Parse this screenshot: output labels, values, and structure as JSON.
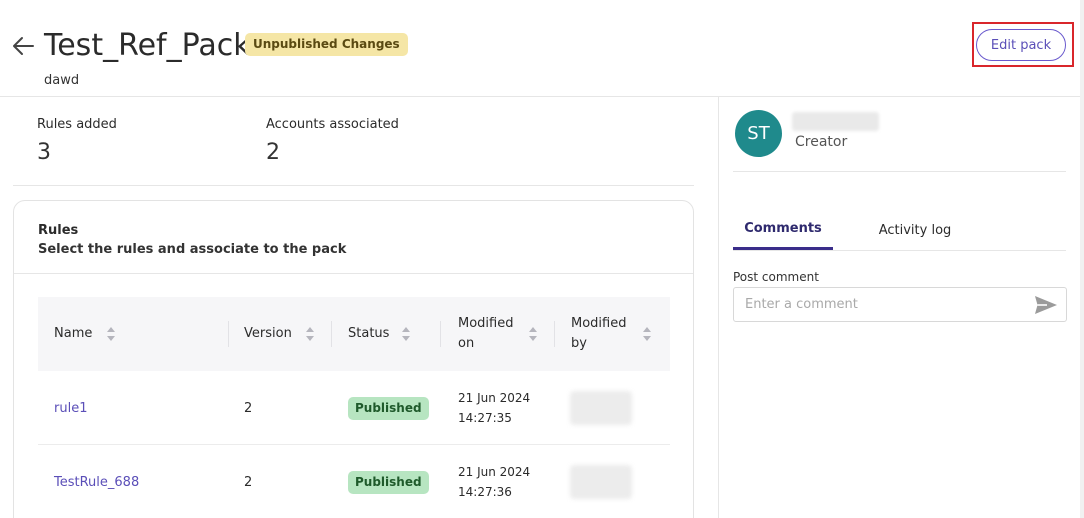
{
  "header": {
    "title": "Test_Ref_Pack",
    "status_badge": "Unpublished Changes",
    "subtitle": "dawd",
    "edit_button": "Edit pack"
  },
  "stats": {
    "rules_added": {
      "label": "Rules added",
      "value": "3"
    },
    "accounts_associated": {
      "label": "Accounts associated",
      "value": "2"
    }
  },
  "rules": {
    "title": "Rules",
    "description": "Select the rules and associate to the pack",
    "columns": [
      "Name",
      "Version",
      "Status",
      "Modified on",
      "Modified by"
    ],
    "rows": [
      {
        "name": "rule1",
        "version": "2",
        "status": "Published",
        "modified_date": "21 Jun 2024",
        "modified_time": "14:27:35"
      },
      {
        "name": "TestRule_688",
        "version": "2",
        "status": "Published",
        "modified_date": "21 Jun 2024",
        "modified_time": "14:27:36"
      }
    ]
  },
  "creator": {
    "initials": "ST",
    "role": "Creator"
  },
  "tabs": {
    "comments": "Comments",
    "activity_log": "Activity log"
  },
  "comment": {
    "label": "Post comment",
    "placeholder": "Enter a comment"
  },
  "colors": {
    "accent": "#5b4fb8",
    "avatar": "#1f8a8c",
    "unpublished_badge": "#f5e6a6",
    "published_badge": "#b7e5c1",
    "highlight": "#d9262b"
  },
  "icons": {
    "back": "arrow-left-icon",
    "sort": "sort-icon",
    "send": "send-icon"
  }
}
